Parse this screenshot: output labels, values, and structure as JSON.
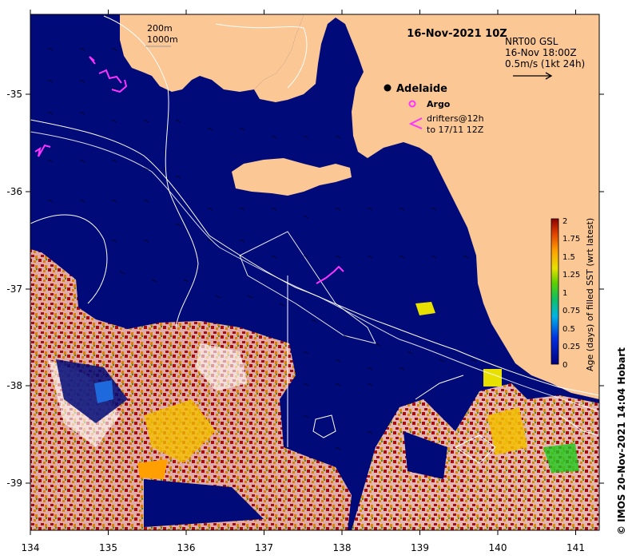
{
  "map": {
    "date_title": "16-Nov-2021 10Z",
    "product_lines": [
      "NRT00 GSL",
      "16-Nov 18:00Z",
      "0.5m/s (1kt 24h)"
    ],
    "bathymetry_labels": [
      "200m",
      "1000m"
    ],
    "legend": {
      "city": "Adelaide",
      "argo": "Argo",
      "drifter_lines": [
        "drifters@12h",
        "to 17/11 12Z"
      ]
    },
    "lon_ticks": [
      "134",
      "135",
      "136",
      "137",
      "138",
      "139",
      "140",
      "141"
    ],
    "lat_ticks": [
      "-35",
      "-36",
      "-37",
      "-38",
      "-39"
    ],
    "lon_range": [
      134,
      141.3
    ],
    "lat_range": [
      -39.5,
      -34.2
    ],
    "colors": {
      "ocean": "#000a78",
      "land": "#fbc795",
      "contour": "#ffffff",
      "argo": "#ff33ff"
    }
  },
  "colorbar": {
    "title": "Age (days) of filled SST (wrt latest)",
    "ticks": [
      "2",
      "1.75",
      "1.5",
      "1.25",
      "1",
      "0.75",
      "0.5",
      "0.25",
      "0"
    ]
  },
  "credit": "© IMOS 20-Nov-2021 14:04 Hobart"
}
